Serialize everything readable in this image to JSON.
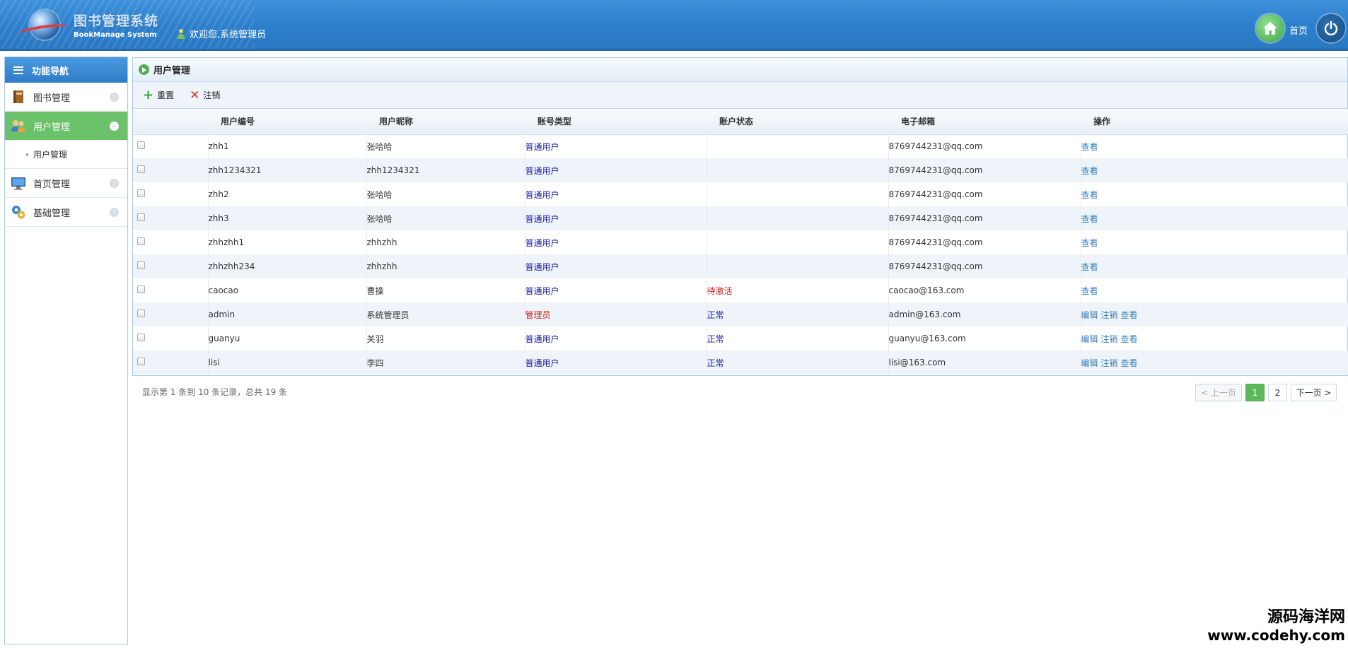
{
  "header": {
    "title": "图书管理系统",
    "subtitle": "BookManage System",
    "welcome": "欢迎您,系统管理员",
    "home_label": "首页"
  },
  "sidebar": {
    "title": "功能导航",
    "items": [
      {
        "label": "图书管理",
        "icon": "book-icon",
        "active": false
      },
      {
        "label": "用户管理",
        "icon": "users-icon",
        "active": true
      },
      {
        "label": "首页管理",
        "icon": "monitor-icon",
        "active": false
      },
      {
        "label": "基础管理",
        "icon": "gears-icon",
        "active": false
      }
    ],
    "sub_items": [
      {
        "label": "用户管理"
      }
    ]
  },
  "panel": {
    "title": "用户管理",
    "toolbar": {
      "reset_label": "重置",
      "cancel_label": "注销"
    }
  },
  "table": {
    "columns": [
      "用户编号",
      "用户昵称",
      "账号类型",
      "账户状态",
      "电子邮箱",
      "操作"
    ],
    "rows": [
      {
        "id": "zhh1",
        "nickname": "张哈哈",
        "type": "普通用户",
        "status": "",
        "email": "8769744231@qq.com",
        "ops": [
          "查看"
        ]
      },
      {
        "id": "zhh1234321",
        "nickname": "zhh1234321",
        "type": "普通用户",
        "status": "",
        "email": "8769744231@qq.com",
        "ops": [
          "查看"
        ]
      },
      {
        "id": "zhh2",
        "nickname": "张哈哈",
        "type": "普通用户",
        "status": "",
        "email": "8769744231@qq.com",
        "ops": [
          "查看"
        ]
      },
      {
        "id": "zhh3",
        "nickname": "张哈哈",
        "type": "普通用户",
        "status": "",
        "email": "8769744231@qq.com",
        "ops": [
          "查看"
        ]
      },
      {
        "id": "zhhzhh1",
        "nickname": "zhhzhh",
        "type": "普通用户",
        "status": "",
        "email": "8769744231@qq.com",
        "ops": [
          "查看"
        ]
      },
      {
        "id": "zhhzhh234",
        "nickname": "zhhzhh",
        "type": "普通用户",
        "status": "",
        "email": "8769744231@qq.com",
        "ops": [
          "查看"
        ]
      },
      {
        "id": "caocao",
        "nickname": "曹操",
        "type": "普通用户",
        "status": "待激活",
        "email": "caocao@163.com",
        "ops": [
          "查看"
        ]
      },
      {
        "id": "admin",
        "nickname": "系统管理员",
        "type": "管理员",
        "status": "正常",
        "email": "admin@163.com",
        "ops": [
          "编辑",
          "注销",
          "查看"
        ]
      },
      {
        "id": "guanyu",
        "nickname": "关羽",
        "type": "普通用户",
        "status": "正常",
        "email": "guanyu@163.com",
        "ops": [
          "编辑",
          "注销",
          "查看"
        ]
      },
      {
        "id": "lisi",
        "nickname": "李四",
        "type": "普通用户",
        "status": "正常",
        "email": "lisi@163.com",
        "ops": [
          "编辑",
          "注销",
          "查看"
        ]
      }
    ]
  },
  "pagination": {
    "info": "显示第 1 条到 10 条记录，总共 19 条",
    "prev_label": "< 上一页",
    "pages": [
      "1",
      "2"
    ],
    "current": "1",
    "next_label": "下一页 >"
  },
  "watermark": {
    "line1": "源码海洋网",
    "line2": "www.codehy.com"
  },
  "colors": {
    "header_blue": "#2d7fcc",
    "active_green": "#6cc26b",
    "admin_red": "#d4201c",
    "user_navy": "#1a1a9e",
    "link_blue": "#3a7fb8"
  }
}
